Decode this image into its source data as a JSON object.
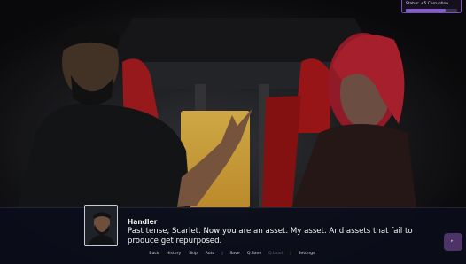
{
  "status": {
    "label": "Status: +5 Corruption",
    "progress": 0.78,
    "fill_color": "#8a5ad6"
  },
  "dialogue": {
    "speaker": "Handler",
    "text": "Past tense, Scarlet. Now you are an asset. My asset. And assets that fail to produce get repurposed."
  },
  "quick_menu": [
    {
      "label": "Back",
      "enabled": true
    },
    {
      "label": "History",
      "enabled": true
    },
    {
      "label": "Skip",
      "enabled": true
    },
    {
      "label": "Auto",
      "enabled": true
    },
    {
      "label": "Save",
      "enabled": true
    },
    {
      "label": "Q.Save",
      "enabled": true
    },
    {
      "label": "Q.Load",
      "enabled": false
    },
    {
      "label": "Settings",
      "enabled": true
    }
  ],
  "separator": "|",
  "colors": {
    "accent": "#7b4fc4",
    "dialog_bg": "#0a0e1a",
    "text": "#f4f4f4"
  },
  "icons": {
    "continue": "chevron-right-icon"
  }
}
